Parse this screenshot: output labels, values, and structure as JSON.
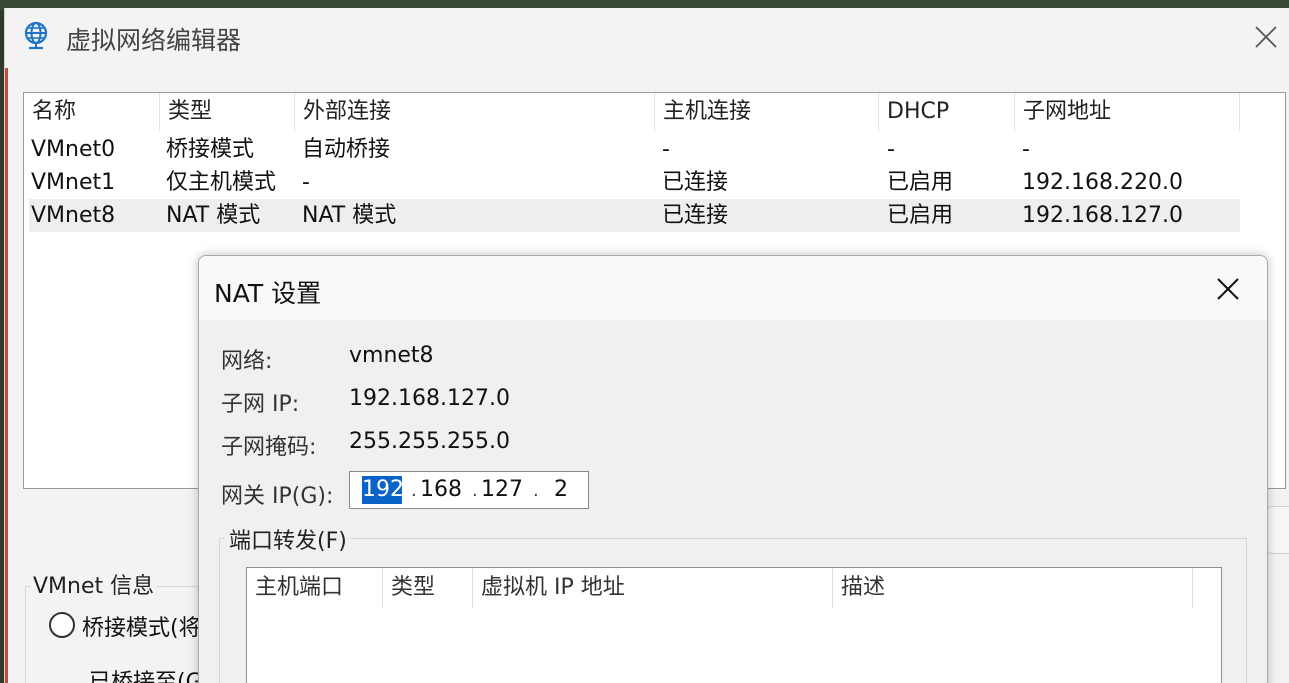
{
  "main_window": {
    "title": "虚拟网络编辑器",
    "title_icon": "globe-icon",
    "close_icon": "close-icon"
  },
  "network_table": {
    "columns": [
      "名称",
      "类型",
      "外部连接",
      "主机连接",
      "DHCP",
      "子网地址"
    ],
    "rows": [
      {
        "name": "VMnet0",
        "type": "桥接模式",
        "external": "自动桥接",
        "host": "-",
        "dhcp": "-",
        "subnet": "-"
      },
      {
        "name": "VMnet1",
        "type": "仅主机模式",
        "external": "-",
        "host": "已连接",
        "dhcp": "已启用",
        "subnet": "192.168.220.0"
      },
      {
        "name": "VMnet8",
        "type": "NAT 模式",
        "external": "NAT 模式",
        "host": "已连接",
        "dhcp": "已启用",
        "subnet": "192.168.127.0"
      }
    ],
    "selected_row": "VMnet8"
  },
  "vmnet_info": {
    "title": "VMnet 信息",
    "bridged_radio_label": "桥接模式(将",
    "bridged_to_label": "已桥接至(G"
  },
  "nat_dialog": {
    "title": "NAT 设置",
    "network_label": "网络:",
    "network_value": "vmnet8",
    "subnet_ip_label": "子网 IP:",
    "subnet_ip_value": "192.168.127.0",
    "subnet_mask_label": "子网掩码:",
    "subnet_mask_value": "255.255.255.0",
    "gateway_label": "网关 IP(G):",
    "gateway_octets": [
      "192",
      "168",
      "127",
      "2"
    ],
    "port_forwarding_title": "端口转发(F)",
    "port_forwarding_columns": [
      "主机端口",
      "类型",
      "虚拟机 IP 地址",
      "描述"
    ]
  },
  "colors": {
    "selection": "#0a63c9",
    "icon_blue": "#1f74c9"
  }
}
